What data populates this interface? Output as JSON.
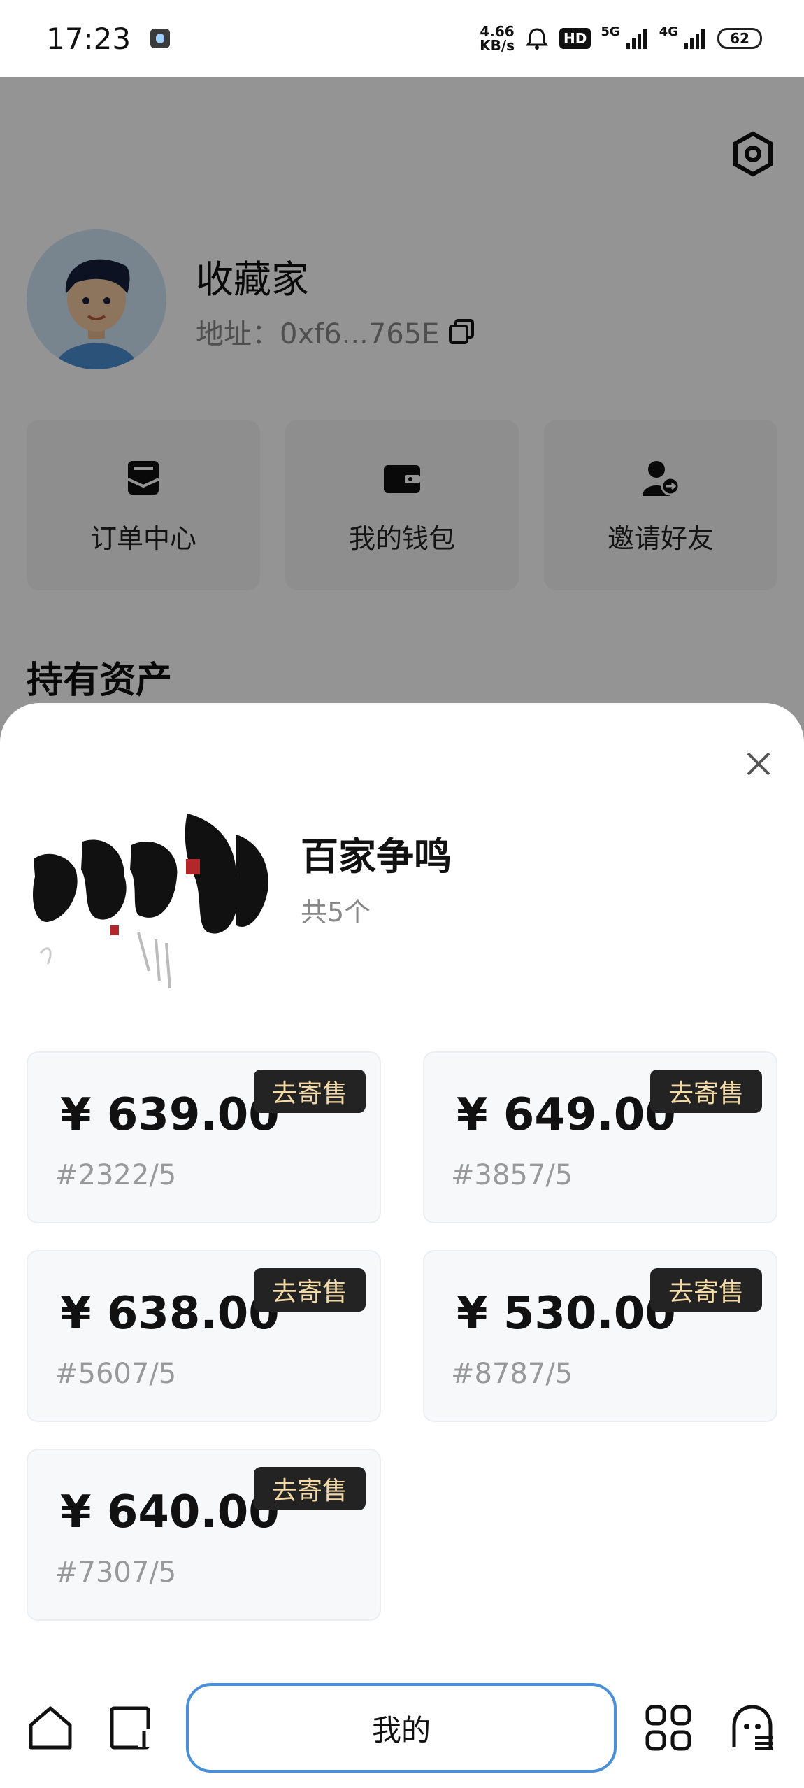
{
  "status_bar": {
    "time": "17:23",
    "net_speed_value": "4.66",
    "net_speed_unit": "KB/s",
    "hd_label": "HD",
    "signal_1_label": "5G",
    "signal_2_label": "4G",
    "battery": "62"
  },
  "profile": {
    "name": "收藏家",
    "address": "地址：0xf6...765E"
  },
  "quick_actions": [
    {
      "label": "订单中心",
      "icon": "order-icon"
    },
    {
      "label": "我的钱包",
      "icon": "wallet-icon"
    },
    {
      "label": "邀请好友",
      "icon": "invite-user-icon"
    }
  ],
  "section_title": "持有资产",
  "sheet": {
    "collection_name": "百家争鸣",
    "collection_count": "共5个",
    "items": [
      {
        "price": "¥ 639.00",
        "serial": "#2322/5",
        "button": "去寄售"
      },
      {
        "price": "¥ 649.00",
        "serial": "#3857/5",
        "button": "去寄售"
      },
      {
        "price": "¥ 638.00",
        "serial": "#5607/5",
        "button": "去寄售"
      },
      {
        "price": "¥ 530.00",
        "serial": "#8787/5",
        "button": "去寄售"
      },
      {
        "price": "¥ 640.00",
        "serial": "#7307/5",
        "button": "去寄售"
      }
    ]
  },
  "bottom_nav": {
    "center_label": "我的",
    "icons": [
      "home-icon",
      "market-icon",
      "apps-icon",
      "chat-icon"
    ]
  },
  "colors": {
    "sell_button_bg": "#232323",
    "sell_button_text": "#f2d9a6",
    "nav_center_border": "#4a90d9",
    "card_bg": "#f7f8fa"
  }
}
